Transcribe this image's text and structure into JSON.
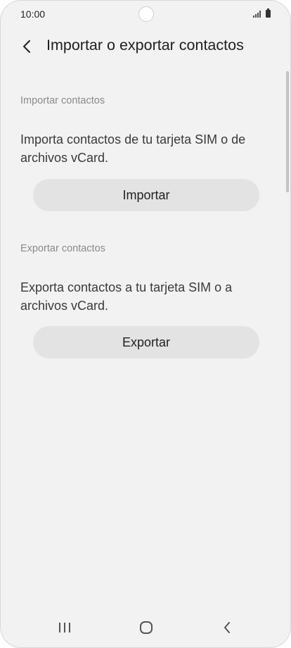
{
  "status_bar": {
    "time": "10:00",
    "icons": [
      "signal-icon",
      "battery-icon"
    ]
  },
  "header": {
    "back_icon": "back-arrow-icon",
    "title": "Importar o exportar contactos"
  },
  "import_section": {
    "heading": "Importar contactos",
    "description": "Importa contactos de tu tarjeta SIM o de archivos vCard.",
    "button_label": "Importar"
  },
  "export_section": {
    "heading": "Exportar contactos",
    "description": "Exporta contactos a tu tarjeta SIM o a archivos vCard.",
    "button_label": "Exportar"
  },
  "nav_bar": {
    "items": [
      "recent-apps-icon",
      "home-icon",
      "back-icon"
    ]
  },
  "colors": {
    "background": "#f2f2f2",
    "button_bg": "#e3e3e3",
    "section_heading": "#8a8a8a",
    "text": "#3a3a3a"
  }
}
